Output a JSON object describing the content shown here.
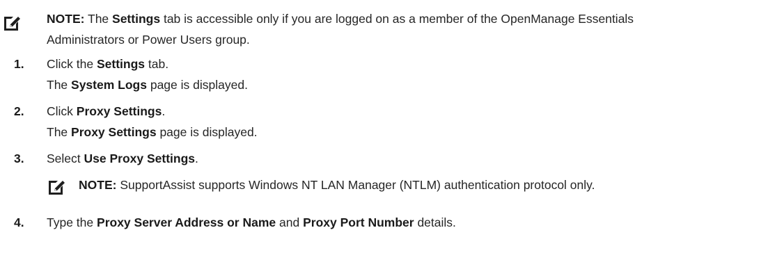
{
  "top_note": {
    "icon": "pencil-note-icon",
    "label": "NOTE:",
    "parts": [
      "The",
      "Settings",
      "tab is accessible only if you are logged on as a member of the OpenManage Essentials"
    ],
    "line2": "Administrators or Power Users group."
  },
  "steps": [
    {
      "number": "1.",
      "line1": [
        "Click the",
        "Settings",
        "tab."
      ],
      "line2": [
        "The",
        "System Logs",
        "page is displayed."
      ]
    },
    {
      "number": "2.",
      "line1": [
        "Click",
        "Proxy Settings",
        "."
      ],
      "line2": [
        "The",
        "Proxy Settings",
        "page is displayed."
      ]
    },
    {
      "number": "3.",
      "line1": [
        "Select",
        "Use Proxy Settings",
        "."
      ],
      "note": {
        "icon": "pencil-note-icon",
        "label": "NOTE:",
        "text": "SupportAssist supports Windows NT LAN Manager (NTLM) authentication protocol only."
      }
    },
    {
      "number": "4.",
      "line1": [
        "Type the",
        "Proxy Server Address or Name",
        "and",
        "Proxy Port Number",
        "details."
      ]
    }
  ]
}
